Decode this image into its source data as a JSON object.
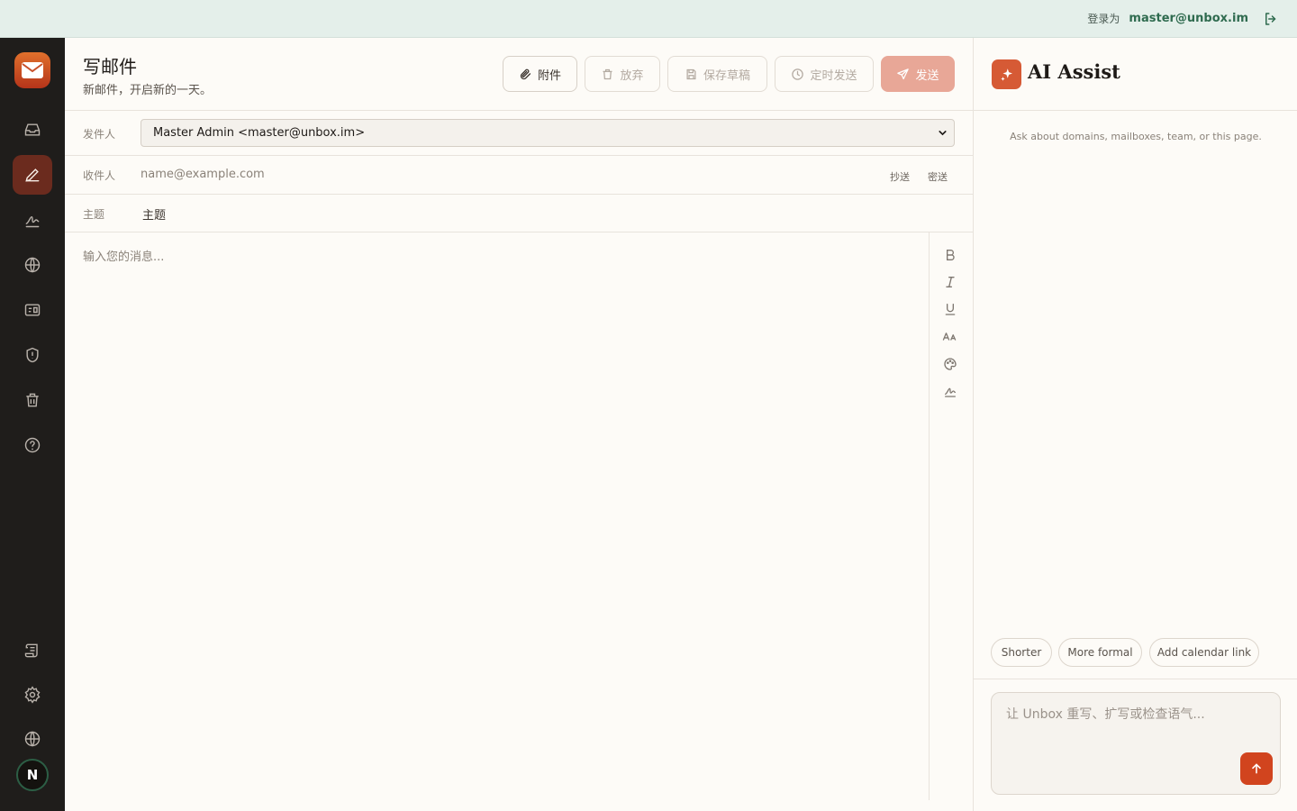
{
  "topbar": {
    "signed_in_label": "登录为",
    "user_email": "master@unbox.im"
  },
  "rail": {
    "avatar_initial": "N"
  },
  "compose": {
    "title": "写邮件",
    "subtitle": "新邮件，开启新的一天。",
    "toolbar": {
      "attach": "附件",
      "discard": "放弃",
      "save_draft": "保存草稿",
      "schedule": "定时发送",
      "send": "发送"
    },
    "from_label": "发件人",
    "from_value": "Master Admin <master@unbox.im>",
    "to_label": "收件人",
    "to_placeholder": "name@example.com",
    "cc": "抄送",
    "bcc": "密送",
    "subject_label": "主题",
    "subject_placeholder": "主题",
    "body_placeholder": "输入您的消息..."
  },
  "ai_assist": {
    "title": "AI Assist",
    "hint": "Ask about domains, mailboxes, team, or this page.",
    "chips": [
      "Shorter",
      "More formal",
      "Add calendar link"
    ],
    "input_placeholder": "让 Unbox 重写、扩写或检查语气..."
  },
  "colors": {
    "accent": "#d1441e",
    "rail_bg": "#1f1d1b",
    "topbar_bg": "#e4efea",
    "active_nav": "#6b2b1e"
  }
}
